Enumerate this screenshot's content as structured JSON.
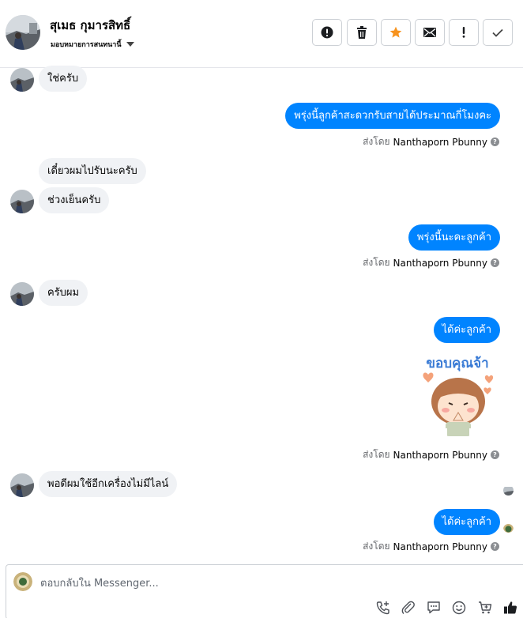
{
  "header": {
    "contact_name": "สุเมธ กุมารสิทธิ์",
    "assign_label": "มอบหมายการสนทนานี้"
  },
  "colors": {
    "accent": "#0084ff",
    "star": "#f7931e",
    "incoming_bg": "#f0f2f5"
  },
  "messages": {
    "in_1": "ใช่ครับ",
    "out_1": "พรุ่งนี้ลูกค้าสะดวกรับสายได้ประมาณกี่โมงคะ",
    "in_2": "เดี๋ยวผมไปรับนะครับ",
    "in_3": "ช่วงเย็นครับ",
    "out_2": "พรุ่งนี้นะคะลูกค้า",
    "in_4": "ครับผม",
    "out_3": "ได้ค่ะลูกค้า",
    "sticker_text": "ขอบคุณจ้า",
    "in_5": "พอดีผมใช้อีกเครื่องไม่มีไลน์",
    "out_4": "ได้ค่ะลูกค้า"
  },
  "sent_by": {
    "prefix": "ส่งโดย",
    "name": "Nanthaporn Pbunny"
  },
  "composer": {
    "placeholder": "ตอบกลับใน Messenger..."
  }
}
